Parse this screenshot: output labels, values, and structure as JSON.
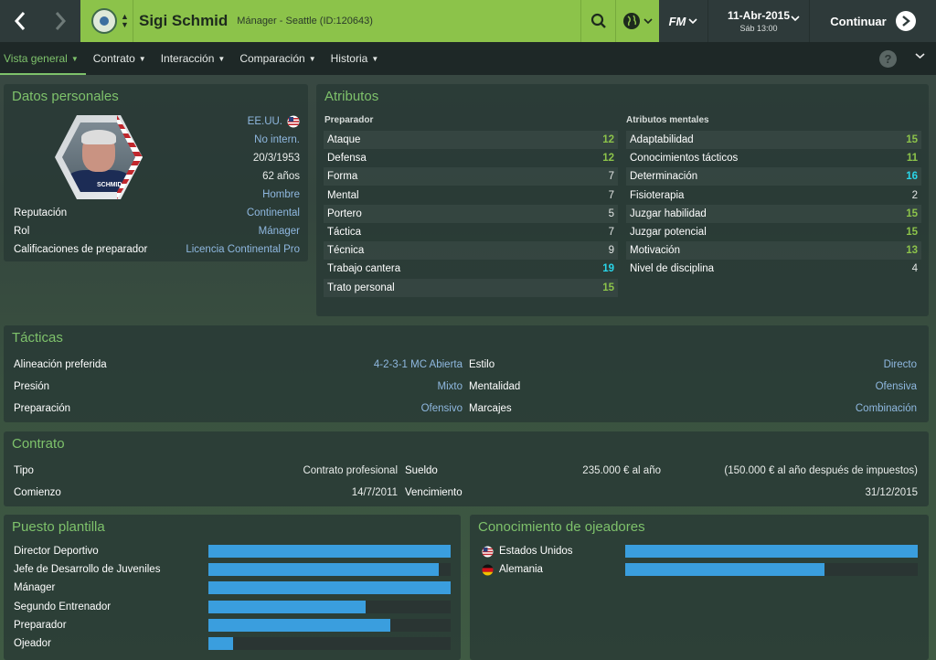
{
  "nav": {
    "back": "‹",
    "forward": "›"
  },
  "header": {
    "name": "Sigi Schmid",
    "subtitle": "Mánager - Seattle (ID:120643)",
    "fm_label": "FM",
    "date": "11-Abr-2015",
    "date_sub": "Sáb 13:00",
    "continue_label": "Continuar"
  },
  "tabs": [
    "Vista general",
    "Contrato",
    "Interacción",
    "Comparación",
    "Historia"
  ],
  "personal": {
    "title": "Datos personales",
    "nationality": "EE.UU.",
    "intl": "No intern.",
    "dob": "20/3/1953",
    "age": "62 años",
    "gender": "Hombre",
    "photo_label": "SCHMID",
    "rows": [
      {
        "label": "Reputación",
        "value": "Continental"
      },
      {
        "label": "Rol",
        "value": "Mánager"
      },
      {
        "label": "Calificaciones de preparador",
        "value": "Licencia Continental Pro"
      }
    ]
  },
  "attributes": {
    "title": "Atributos",
    "coach_heading": "Preparador",
    "mental_heading": "Atributos mentales",
    "coach": [
      {
        "name": "Ataque",
        "value": "12",
        "color": "green"
      },
      {
        "name": "Defensa",
        "value": "12",
        "color": "green"
      },
      {
        "name": "Forma",
        "value": "7",
        "color": "white"
      },
      {
        "name": "Mental",
        "value": "7",
        "color": "white"
      },
      {
        "name": "Portero",
        "value": "5",
        "color": "white"
      },
      {
        "name": "Táctica",
        "value": "7",
        "color": "white"
      },
      {
        "name": "Técnica",
        "value": "9",
        "color": "white"
      },
      {
        "name": "Trabajo cantera",
        "value": "19",
        "color": "cyan"
      },
      {
        "name": "Trato personal",
        "value": "15",
        "color": "green"
      }
    ],
    "mental": [
      {
        "name": "Adaptabilidad",
        "value": "15",
        "color": "green"
      },
      {
        "name": "Conocimientos tácticos",
        "value": "11",
        "color": "green"
      },
      {
        "name": "Determinación",
        "value": "16",
        "color": "cyan"
      },
      {
        "name": "Fisioterapia",
        "value": "2",
        "color": "white"
      },
      {
        "name": "Juzgar habilidad",
        "value": "15",
        "color": "green"
      },
      {
        "name": "Juzgar potencial",
        "value": "15",
        "color": "green"
      },
      {
        "name": "Motivación",
        "value": "13",
        "color": "green"
      },
      {
        "name": "Nivel de disciplina",
        "value": "4",
        "color": "white"
      }
    ]
  },
  "tactics": {
    "title": "Tácticas",
    "left": [
      {
        "label": "Alineación preferida",
        "value": "4-2-3-1 MC Abierta"
      },
      {
        "label": "Presión",
        "value": "Mixto"
      },
      {
        "label": "Preparación",
        "value": "Ofensivo"
      }
    ],
    "right": [
      {
        "label": "Estilo",
        "value": "Directo"
      },
      {
        "label": "Mentalidad",
        "value": "Ofensiva"
      },
      {
        "label": "Marcajes",
        "value": "Combinación"
      }
    ]
  },
  "contract": {
    "title": "Contrato",
    "type_label": "Tipo",
    "type_value": "Contrato profesional",
    "start_label": "Comienzo",
    "start_value": "14/7/2011",
    "salary_label": "Sueldo",
    "salary_value": "235.000 € al año",
    "salary_after": "(150.000 € al año después de impuestos)",
    "expiry_label": "Vencimiento",
    "expiry_value": "31/12/2015"
  },
  "staff_roles": {
    "title": "Puesto plantilla",
    "items": [
      {
        "label": "Director Deportivo",
        "fill": 1.0
      },
      {
        "label": "Jefe de Desarrollo de Juveniles",
        "fill": 0.95
      },
      {
        "label": "Mánager",
        "fill": 1.0
      },
      {
        "label": "Segundo Entrenador",
        "fill": 0.65
      },
      {
        "label": "Preparador",
        "fill": 0.75
      },
      {
        "label": "Ojeador",
        "fill": 0.1
      }
    ]
  },
  "scout_knowledge": {
    "title": "Conocimiento de ojeadores",
    "items": [
      {
        "label": "Estados Unidos",
        "fill": 1.0,
        "flag": "usa-flag"
      },
      {
        "label": "Alemania",
        "fill": 0.68,
        "flag": "germany-flag"
      }
    ]
  }
}
